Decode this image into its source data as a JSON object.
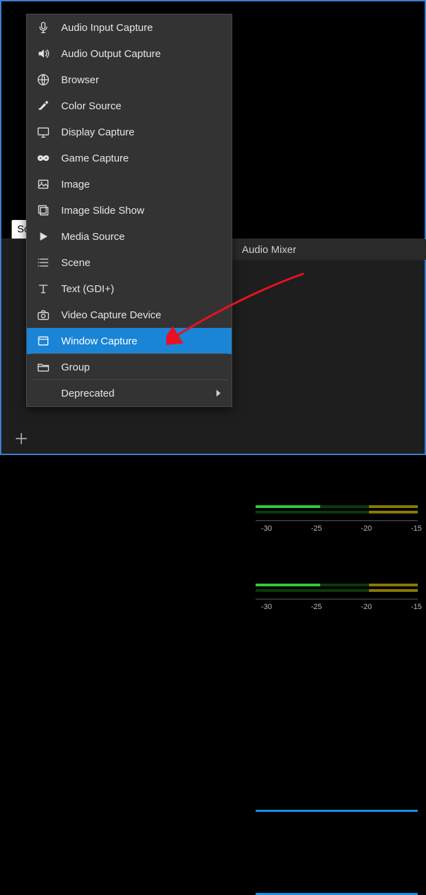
{
  "docks": {
    "sources_tab": "Sources",
    "audio_mixer_tab": "Audio Mixer"
  },
  "mixer": {
    "tick_labels": [
      "-30",
      "-25",
      "-20",
      "-15"
    ]
  },
  "menu": {
    "items": [
      {
        "id": "audio-input-capture",
        "icon": "mic",
        "label": "Audio Input Capture"
      },
      {
        "id": "audio-output-capture",
        "icon": "speaker",
        "label": "Audio Output Capture"
      },
      {
        "id": "browser",
        "icon": "globe",
        "label": "Browser"
      },
      {
        "id": "color-source",
        "icon": "brush",
        "label": "Color Source"
      },
      {
        "id": "display-capture",
        "icon": "monitor",
        "label": "Display Capture"
      },
      {
        "id": "game-capture",
        "icon": "gamepad",
        "label": "Game Capture"
      },
      {
        "id": "image",
        "icon": "image",
        "label": "Image"
      },
      {
        "id": "image-slide-show",
        "icon": "slides",
        "label": "Image Slide Show"
      },
      {
        "id": "media-source",
        "icon": "play",
        "label": "Media Source"
      },
      {
        "id": "scene",
        "icon": "list",
        "label": "Scene"
      },
      {
        "id": "text-gdi",
        "icon": "text",
        "label": "Text (GDI+)"
      },
      {
        "id": "video-capture-device",
        "icon": "camera",
        "label": "Video Capture Device"
      },
      {
        "id": "window-capture",
        "icon": "window",
        "label": "Window Capture",
        "highlight": true
      }
    ],
    "group_label": "Group",
    "deprecated_label": "Deprecated"
  }
}
